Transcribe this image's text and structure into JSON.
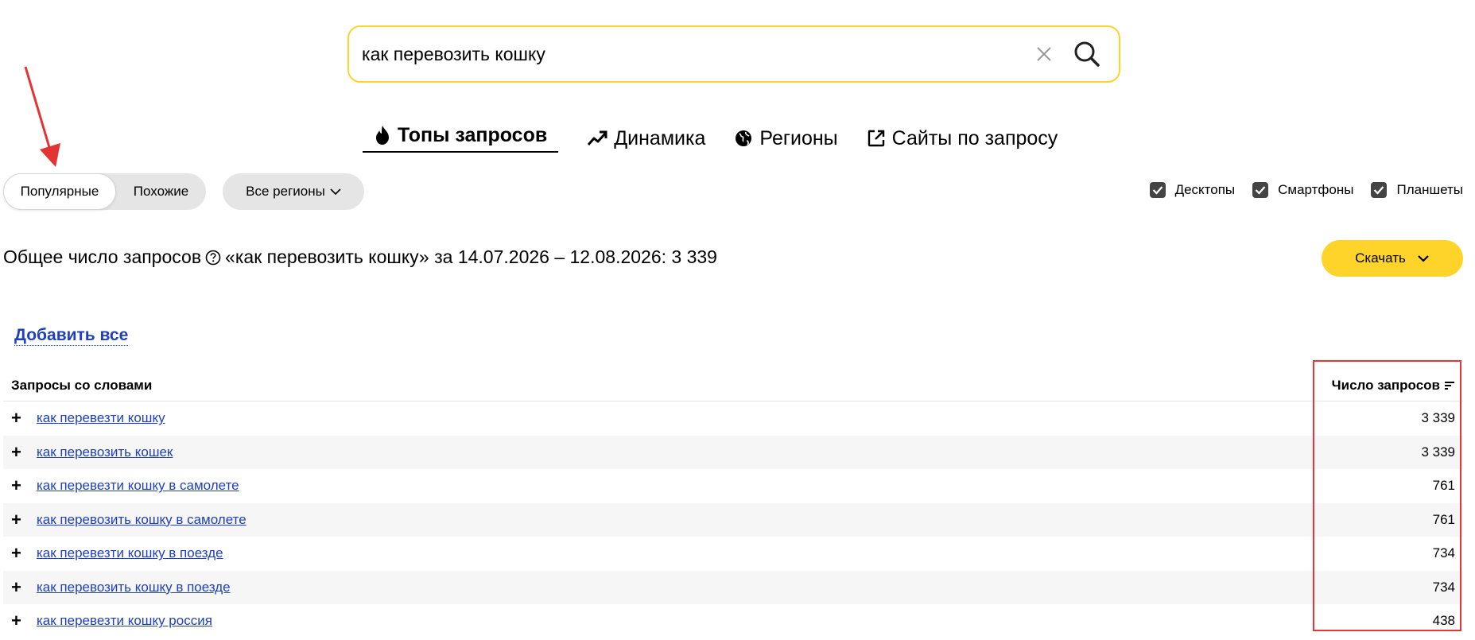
{
  "search": {
    "query": "как перевозить кошку"
  },
  "tabs": [
    {
      "label": "Топы запросов",
      "icon": "fire-icon",
      "active": true
    },
    {
      "label": "Динамика",
      "icon": "trend-icon",
      "active": false
    },
    {
      "label": "Регионы",
      "icon": "globe-icon",
      "active": false
    },
    {
      "label": "Сайты по запросу",
      "icon": "external-link-icon",
      "active": false
    }
  ],
  "mode_toggle": {
    "popular_label": "Популярные",
    "similar_label": "Похожие",
    "selected": "Популярные"
  },
  "region_selector": {
    "label": "Все регионы"
  },
  "devices": [
    {
      "label": "Десктопы",
      "checked": true
    },
    {
      "label": "Смартфоны",
      "checked": true
    },
    {
      "label": "Планшеты",
      "checked": true
    }
  ],
  "summary": {
    "prefix": "Общее число запросов",
    "suffix": "«как перевозить кошку» за 14.07.2026 – 12.08.2026: 3 339"
  },
  "download_label": "Скачать",
  "add_all_label": "Добавить все",
  "table": {
    "col_query": "Запросы со словами",
    "col_count": "Число запросов",
    "rows": [
      {
        "query": "как перевезти кошку",
        "count": "3 339"
      },
      {
        "query": "как перевозить кошек",
        "count": "3 339"
      },
      {
        "query": "как перевезти кошку в самолете",
        "count": "761"
      },
      {
        "query": "как перевозить кошку в самолете",
        "count": "761"
      },
      {
        "query": "как перевезти кошку в поезде",
        "count": "734"
      },
      {
        "query": "как перевозить кошку в поезде",
        "count": "734"
      },
      {
        "query": "как перевезти кошку россия",
        "count": "438"
      }
    ]
  },
  "colors": {
    "accent_yellow": "#fed42b",
    "link_blue": "#1e3fbf",
    "annotation_red": "#e33333"
  }
}
